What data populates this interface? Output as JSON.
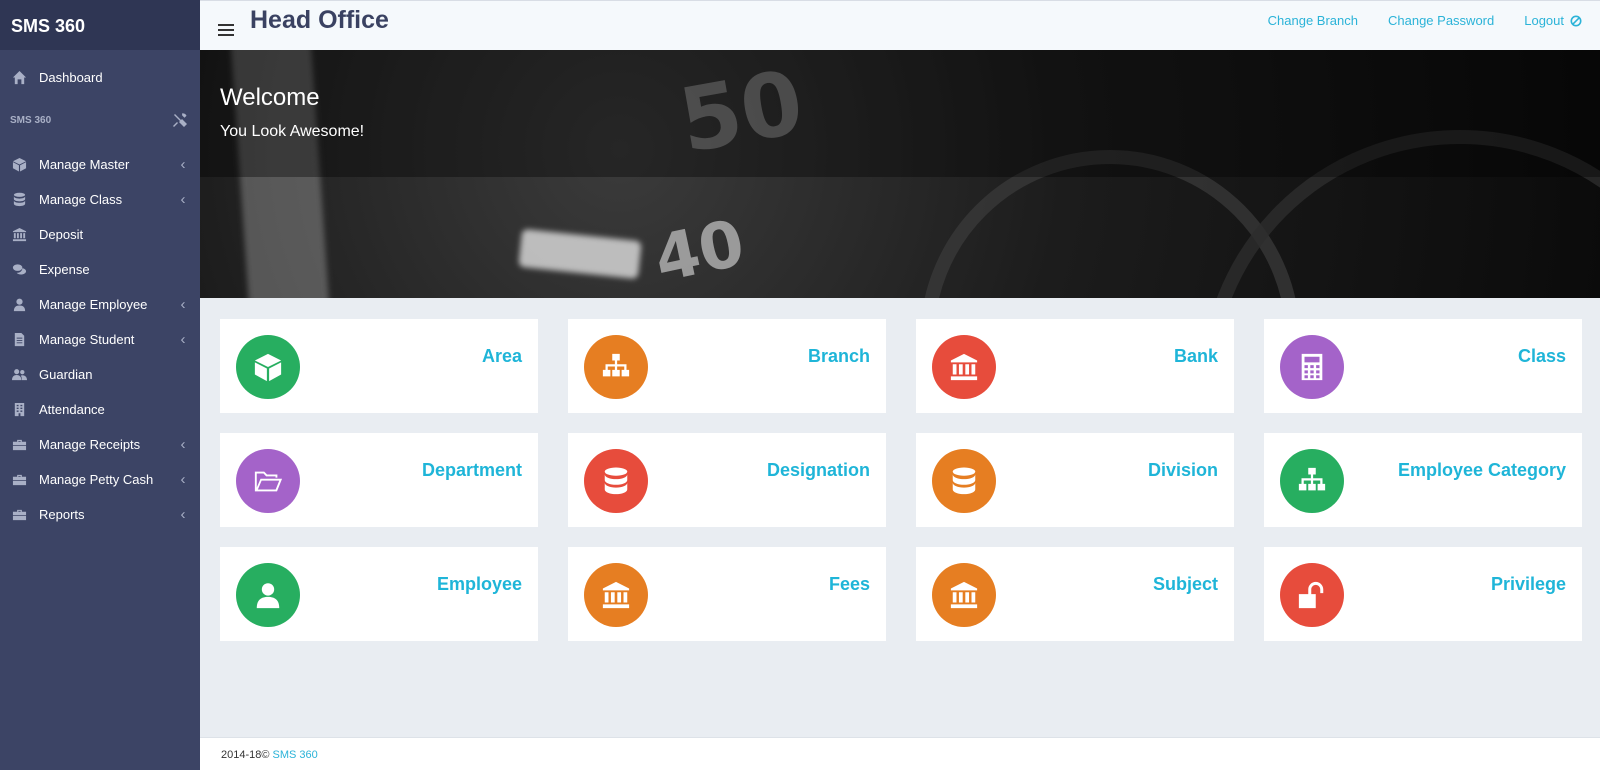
{
  "app": {
    "brand": "SMS 360"
  },
  "header": {
    "title": "Head Office",
    "links": [
      {
        "label": "Change Branch"
      },
      {
        "label": "Change Password"
      },
      {
        "label": "Logout"
      }
    ]
  },
  "sidebar": {
    "dashboard": {
      "label": "Dashboard",
      "icon": "home-icon"
    },
    "section_label": "SMS 360",
    "items": [
      {
        "label": "Manage Master",
        "icon": "cube-icon",
        "chevron": "‹"
      },
      {
        "label": "Manage Class",
        "icon": "database-icon",
        "chevron": "‹"
      },
      {
        "label": "Deposit",
        "icon": "bank-icon",
        "chevron": ""
      },
      {
        "label": "Expense",
        "icon": "coins-icon",
        "chevron": ""
      },
      {
        "label": "Manage Employee",
        "icon": "user-icon",
        "chevron": "‹"
      },
      {
        "label": "Manage Student",
        "icon": "document-icon",
        "chevron": "‹"
      },
      {
        "label": "Guardian",
        "icon": "users-icon",
        "chevron": ""
      },
      {
        "label": "Attendance",
        "icon": "building-icon",
        "chevron": ""
      },
      {
        "label": "Manage Receipts",
        "icon": "briefcase-icon",
        "chevron": "‹"
      },
      {
        "label": "Manage Petty Cash",
        "icon": "briefcase-icon",
        "chevron": "‹"
      },
      {
        "label": "Reports",
        "icon": "briefcase-icon",
        "chevron": "‹"
      }
    ]
  },
  "banner": {
    "title": "Welcome",
    "subtitle": "You Look Awesome!",
    "dial_numbers": [
      "50",
      "40"
    ]
  },
  "tiles": [
    {
      "label": "Area",
      "icon": "cube-icon",
      "color": "#27ae60"
    },
    {
      "label": "Branch",
      "icon": "sitemap-icon",
      "color": "#e67e22"
    },
    {
      "label": "Bank",
      "icon": "bank-icon",
      "color": "#e74c3c"
    },
    {
      "label": "Class",
      "icon": "calculator-icon",
      "color": "#a463c9"
    },
    {
      "label": "Department",
      "icon": "folder-open-icon",
      "color": "#a463c9"
    },
    {
      "label": "Designation",
      "icon": "database-icon",
      "color": "#e74c3c"
    },
    {
      "label": "Division",
      "icon": "database-icon",
      "color": "#e67e22"
    },
    {
      "label": "Employee Category",
      "icon": "sitemap-icon",
      "color": "#27ae60"
    },
    {
      "label": "Employee",
      "icon": "user-icon",
      "color": "#27ae60"
    },
    {
      "label": "Fees",
      "icon": "bank-icon",
      "color": "#e67e22"
    },
    {
      "label": "Subject",
      "icon": "bank-icon",
      "color": "#e67e22"
    },
    {
      "label": "Privilege",
      "icon": "unlock-icon",
      "color": "#e74c3c"
    }
  ],
  "footer": {
    "prefix": "2014-18© ",
    "link": "SMS 360"
  },
  "colors": {
    "sidebar": "#3c4465",
    "brand_bar": "#2f3654",
    "accent": "#2bb3d8",
    "tile_label": "#1fb5d8"
  }
}
